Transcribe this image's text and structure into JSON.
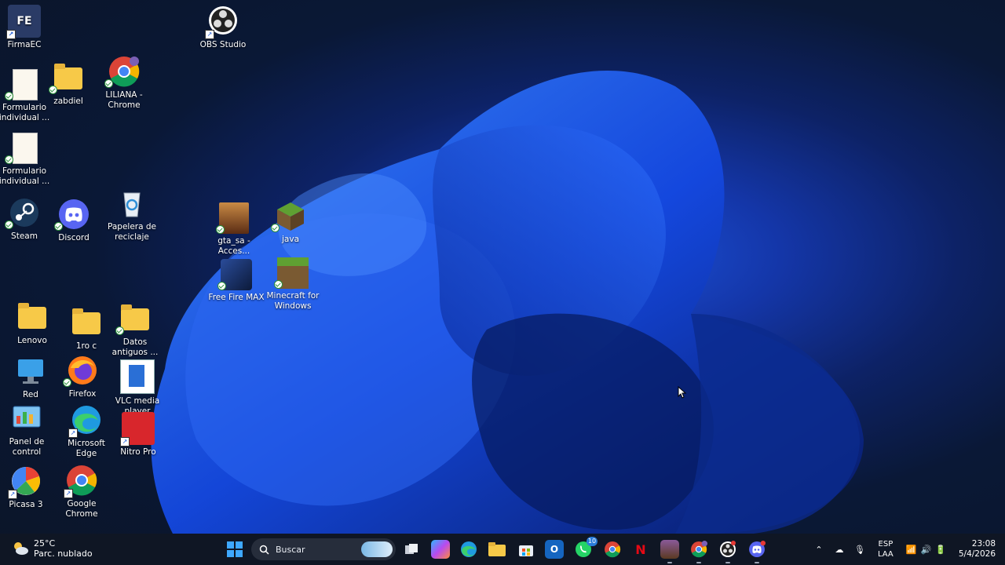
{
  "desktop": {
    "icons": [
      {
        "label": "FirmaEC"
      },
      {
        "label": "OBS Studio"
      },
      {
        "label": "Formulario individual ..."
      },
      {
        "label": "zabdiel"
      },
      {
        "label": "LILIANA - Chrome"
      },
      {
        "label": "Formulario individual ..."
      },
      {
        "label": "Steam"
      },
      {
        "label": "Discord"
      },
      {
        "label": "Papelera de reciclaje"
      },
      {
        "label": "gta_sa - Acces..."
      },
      {
        "label": "java"
      },
      {
        "label": "Free Fire MAX"
      },
      {
        "label": "Minecraft for Windows"
      },
      {
        "label": "Lenovo"
      },
      {
        "label": "1ro c"
      },
      {
        "label": "Datos antiguos ..."
      },
      {
        "label": "Red"
      },
      {
        "label": "Firefox"
      },
      {
        "label": "VLC media player"
      },
      {
        "label": "Panel de control"
      },
      {
        "label": "Microsoft Edge"
      },
      {
        "label": "Nitro Pro"
      },
      {
        "label": "Picasa 3"
      },
      {
        "label": "Google Chrome"
      }
    ]
  },
  "taskbar": {
    "weather": {
      "temp": "25°C",
      "desc": "Parc. nublado"
    },
    "search_label": "Buscar",
    "whatsapp_badge": "10",
    "tray": {
      "lang_top": "ESP",
      "lang_bottom": "LAA",
      "time": "23:08",
      "date": "5/4/2026"
    }
  },
  "colors": {
    "taskbar": "#0f1624",
    "wallpaper_blue": "#1b4fd6",
    "folder": "#f7c948"
  }
}
